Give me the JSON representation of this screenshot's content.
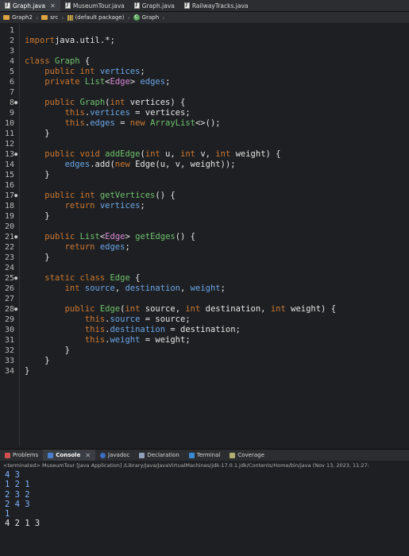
{
  "tabs": [
    "Graph.java",
    "MuseumTour.java",
    "Graph.java",
    "RailwayTracks.java"
  ],
  "breadcrumb": [
    "Graph2",
    "src",
    "(default package)",
    "Graph"
  ],
  "code": [
    [],
    [
      [
        "kw",
        "import"
      ],
      [
        "",
        "java.util.*;"
      ]
    ],
    [],
    [
      [
        "kw",
        "class"
      ],
      [
        "ty",
        "Graph"
      ],
      [
        "",
        " {"
      ]
    ],
    [
      [
        "",
        "    "
      ],
      [
        "kw",
        "public int"
      ],
      [
        "",
        " "
      ],
      [
        "fld",
        "vertices"
      ],
      [
        "",
        ";"
      ]
    ],
    [
      [
        "",
        "    "
      ],
      [
        "kw",
        "private"
      ],
      [
        "",
        " "
      ],
      [
        "ty",
        "List"
      ],
      [
        "",
        "<"
      ],
      [
        "gen",
        "Edge"
      ],
      [
        "",
        "> "
      ],
      [
        "fld",
        "edges"
      ],
      [
        "",
        ";"
      ]
    ],
    [],
    [
      [
        "",
        "    "
      ],
      [
        "kw",
        "public"
      ],
      [
        "",
        " "
      ],
      [
        "ty",
        "Graph"
      ],
      [
        "",
        "("
      ],
      [
        "kw",
        "int"
      ],
      [
        "",
        " vertices) {"
      ]
    ],
    [
      [
        "",
        "        "
      ],
      [
        "kw",
        "this"
      ],
      [
        "",
        "."
      ],
      [
        "fld",
        "vertices"
      ],
      [
        "",
        " = vertices;"
      ]
    ],
    [
      [
        "",
        "        "
      ],
      [
        "kw",
        "this"
      ],
      [
        "",
        "."
      ],
      [
        "fld",
        "edges"
      ],
      [
        "",
        " = "
      ],
      [
        "kw",
        "new"
      ],
      [
        "",
        " "
      ],
      [
        "ty",
        "ArrayList"
      ],
      [
        "",
        "<>();"
      ]
    ],
    [
      [
        "",
        "    }"
      ]
    ],
    [],
    [
      [
        "",
        "    "
      ],
      [
        "kw",
        "public void"
      ],
      [
        "",
        " "
      ],
      [
        "ty",
        "addEdge"
      ],
      [
        "",
        "("
      ],
      [
        "kw",
        "int"
      ],
      [
        "",
        " u, "
      ],
      [
        "kw",
        "int"
      ],
      [
        "",
        " v, "
      ],
      [
        "kw",
        "int"
      ],
      [
        "",
        " weight) {"
      ]
    ],
    [
      [
        "",
        "        "
      ],
      [
        "fld",
        "edges"
      ],
      [
        "",
        ".add("
      ],
      [
        "kw",
        "new"
      ],
      [
        "",
        " Edge(u, v, weight));"
      ]
    ],
    [
      [
        "",
        "    }"
      ]
    ],
    [],
    [
      [
        "",
        "    "
      ],
      [
        "kw",
        "public int"
      ],
      [
        "",
        " "
      ],
      [
        "ty",
        "getVertices"
      ],
      [
        "",
        "() {"
      ]
    ],
    [
      [
        "",
        "        "
      ],
      [
        "kw",
        "return"
      ],
      [
        "",
        " "
      ],
      [
        "fld",
        "vertices"
      ],
      [
        "",
        ";"
      ]
    ],
    [
      [
        "",
        "    }"
      ]
    ],
    [],
    [
      [
        "",
        "    "
      ],
      [
        "kw",
        "public"
      ],
      [
        "",
        " "
      ],
      [
        "ty",
        "List"
      ],
      [
        "",
        "<"
      ],
      [
        "gen",
        "Edge"
      ],
      [
        "",
        "> "
      ],
      [
        "ty",
        "getEdges"
      ],
      [
        "",
        "() {"
      ]
    ],
    [
      [
        "",
        "        "
      ],
      [
        "kw",
        "return"
      ],
      [
        "",
        " "
      ],
      [
        "fld",
        "edges"
      ],
      [
        "",
        ";"
      ]
    ],
    [
      [
        "",
        "    }"
      ]
    ],
    [],
    [
      [
        "",
        "    "
      ],
      [
        "kw",
        "static class"
      ],
      [
        "",
        " "
      ],
      [
        "ty",
        "Edge"
      ],
      [
        "",
        " {"
      ]
    ],
    [
      [
        "",
        "        "
      ],
      [
        "kw",
        "int"
      ],
      [
        "",
        " "
      ],
      [
        "fld",
        "source"
      ],
      [
        "",
        ", "
      ],
      [
        "fld",
        "destination"
      ],
      [
        "",
        ", "
      ],
      [
        "fld",
        "weight"
      ],
      [
        "",
        ";"
      ]
    ],
    [],
    [
      [
        "",
        "        "
      ],
      [
        "kw",
        "public"
      ],
      [
        "",
        " "
      ],
      [
        "ty",
        "Edge"
      ],
      [
        "",
        "("
      ],
      [
        "kw",
        "int"
      ],
      [
        "",
        " source, "
      ],
      [
        "kw",
        "int"
      ],
      [
        "",
        " destination, "
      ],
      [
        "kw",
        "int"
      ],
      [
        "",
        " weight) {"
      ]
    ],
    [
      [
        "",
        "            "
      ],
      [
        "kw",
        "this"
      ],
      [
        "",
        "."
      ],
      [
        "fld",
        "source"
      ],
      [
        "",
        " = source;"
      ]
    ],
    [
      [
        "",
        "            "
      ],
      [
        "kw",
        "this"
      ],
      [
        "",
        "."
      ],
      [
        "fld",
        "destination"
      ],
      [
        "",
        " = destination;"
      ]
    ],
    [
      [
        "",
        "            "
      ],
      [
        "kw",
        "this"
      ],
      [
        "",
        "."
      ],
      [
        "fld",
        "weight"
      ],
      [
        "",
        " = weight;"
      ]
    ],
    [
      [
        "",
        "        }"
      ]
    ],
    [
      [
        "",
        "    }"
      ]
    ],
    [
      [
        "",
        "}"
      ]
    ]
  ],
  "markers": [
    8,
    13,
    17,
    21,
    25,
    28
  ],
  "panel_tabs": [
    "Problems",
    "Console",
    "Javadoc",
    "Declaration",
    "Terminal",
    "Coverage"
  ],
  "console_header": "<terminated> MuseumTour [Java Application] /Library/Java/JavaVirtualMachines/jdk-17.0.1.jdk/Contents/Home/bin/java  (Nov 13, 2023, 11:27:",
  "console_input_lines": [
    "4 3",
    "1 2 1",
    "2 3 2",
    "2 4 3",
    "1"
  ],
  "console_output_lines": [
    "4 2 1 3"
  ]
}
